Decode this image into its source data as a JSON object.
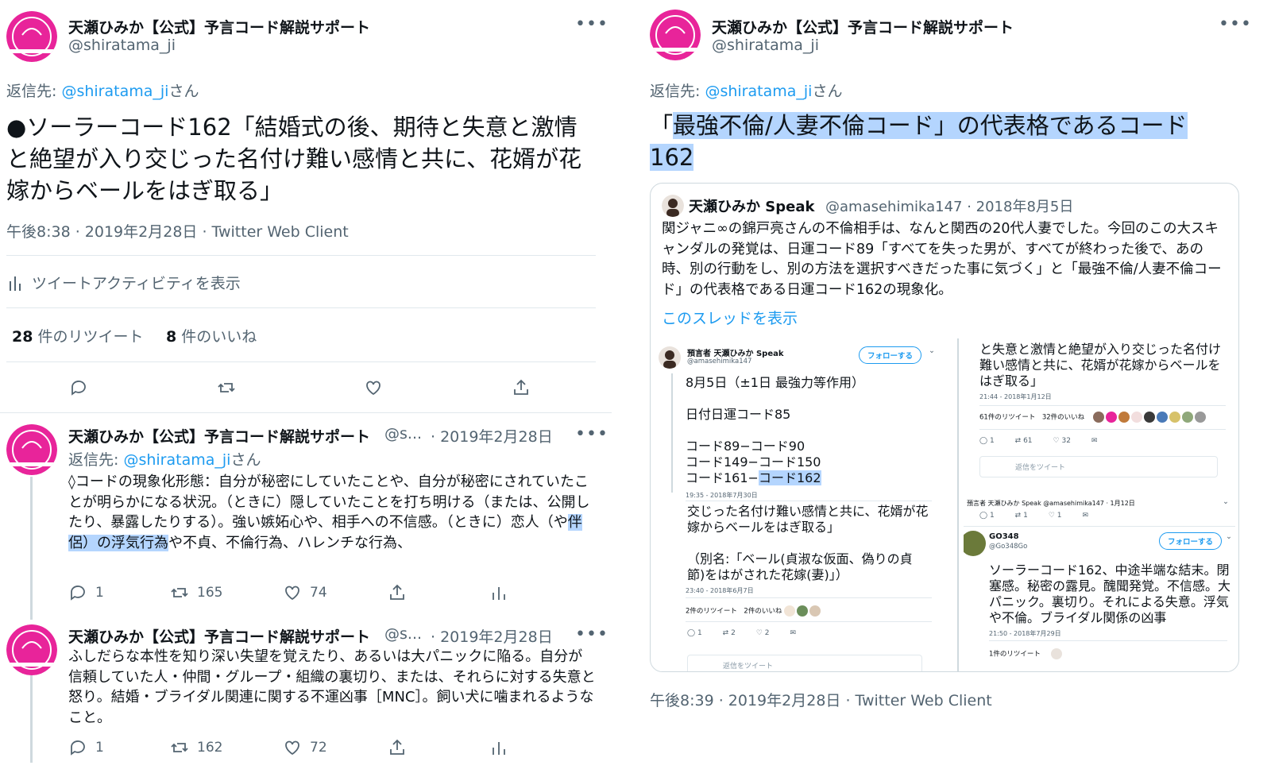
{
  "left": {
    "main": {
      "author_name": "天瀬ひみか【公式】予言コード解説サポート",
      "author_handle": "@shiratama_ji",
      "reply_prefix": "返信先:",
      "reply_handle": "@shiratama_ji",
      "reply_suffix": "さん",
      "text": "●ソーラーコード162「結婚式の後、期待と失意と激情と絶望が入り交じった名付け難い感情と共に、花婿が花嫁からベールをはぎ取る」",
      "timestamp": "午後8:38 · 2019年2月28日 · Twitter Web Client",
      "activity_label": "ツイートアクティビティを表示",
      "retweets_count": "28",
      "retweets_label": "件のリツイート",
      "likes_count": "8",
      "likes_label": "件のいいね"
    },
    "replies": [
      {
        "author_name": "天瀬ひみか【公式】予言コード解説サポート",
        "author_handle": "@s...",
        "date": "· 2019年2月28日",
        "reply_prefix": "返信先:",
        "reply_handle": "@shiratama_ji",
        "reply_suffix": "さん",
        "text_before": "◊コードの現象化形態：自分が秘密にしていたことや、自分が秘密にされていたことが明らかになる状況。（ときに）隠していたことを打ち明ける（または、公開したり、暴露したりする）。強い嫉妬心や、相手への不信感。（ときに）恋人（や",
        "text_highlight": "伴侶）の浮気行為",
        "text_after": "や不貞、不倫行為、ハレンチな行為、",
        "replies": "1",
        "retweets": "165",
        "likes": "74"
      },
      {
        "author_name": "天瀬ひみか【公式】予言コード解説サポート",
        "author_handle": "@s...",
        "date": "· 2019年2月28日",
        "text": "ふしだらな本性を知り深い失望を覚えたり、あるいは大パニックに陥る。自分が信頼していた人・仲間・グループ・組織の裏切り、または、それらに対する失意と怒り。結婚・ブライダル関連に関する不運凶事［MNC］。飼い犬に噛まれるようなこと。",
        "replies": "1",
        "retweets": "162",
        "likes": "72"
      }
    ]
  },
  "right": {
    "author_name": "天瀬ひみか【公式】予言コード解説サポート",
    "author_handle": "@shiratama_ji",
    "reply_prefix": "返信先:",
    "reply_handle": "@shiratama_ji",
    "reply_suffix": "さん",
    "text_prefix": "「",
    "text_highlight_1": "最強不倫/人妻不倫コード」の代表格であるコード",
    "text_highlight_2": "162",
    "timestamp": "午後8:39 · 2019年2月28日 · Twitter Web Client",
    "quote": {
      "author_name": "天瀬ひみか Speak",
      "author_handle": "@amasehimika147 · 2018年8月5日",
      "text": "関ジャニ∞の錦戸亮さんの不倫相手は、なんと関西の20代人妻でした。今回のこの大スキャンダルの発覚は、日運コード89「すべてを失った男が、すべてが終わった後で、あの時、別の行動をし、別の方法を選択すべきだった事に気づく」と「最強不倫/人妻不倫コード」の代表格である日運コード162の現象化。",
      "thread_link": "このスレッドを表示",
      "shot_left": {
        "name": "預言者 天瀬ひみか Speak",
        "handle": "@amasehimika147",
        "follow": "フォローする",
        "lines": [
          "8月5日（±1日 最強力等作用）",
          "日付日運コード85",
          "コード89−コード90",
          "コード149−コード150",
          "コード161−"
        ],
        "highlight": "コード162",
        "time1": "19:35 - 2018年7月30日",
        "text2": "交じった名付け難い感情と共に、花婿が花嫁からベールをはぎ取る」",
        "text3": "（別名:「ベール(貞淑な仮面、偽りの貞節)をはがされた花嫁(妻)」）",
        "time2": "23:40 - 2018年6月7日",
        "stats": "2件のリツイート　2件のいいね",
        "a1": "1",
        "a2": "2",
        "a3": "2",
        "reply_ph": "返信をツイート"
      },
      "shot_right": {
        "text1": "と失意と激情と絶望が入り交じった名付け難い感情と共に、花婿が花嫁からベールをはぎ取る」",
        "time1": "21:44 - 2018年1月12日",
        "stats": "61件のリツイート　32件のいいね",
        "a1": "1",
        "a2": "61",
        "a3": "32",
        "reply_ph": "返信をツイート",
        "mini_header": "預言者 天瀬ひみか Speak @amasehimika147 · 1月12日",
        "b1": "1",
        "b2": "1",
        "b3": "1",
        "name2": "GO348",
        "handle2": "@Go348Go",
        "follow": "フォローする",
        "text2": "ソーラーコード162、中途半端な結末。閉塞感。秘密の露見。醜聞発覚。不信感。大パニック。裏切り。それによる失意。浮気や不倫。ブライダル関係の凶事",
        "time2": "21:50 - 2018年7月29日",
        "stats2": "1件のリツイート"
      }
    }
  }
}
